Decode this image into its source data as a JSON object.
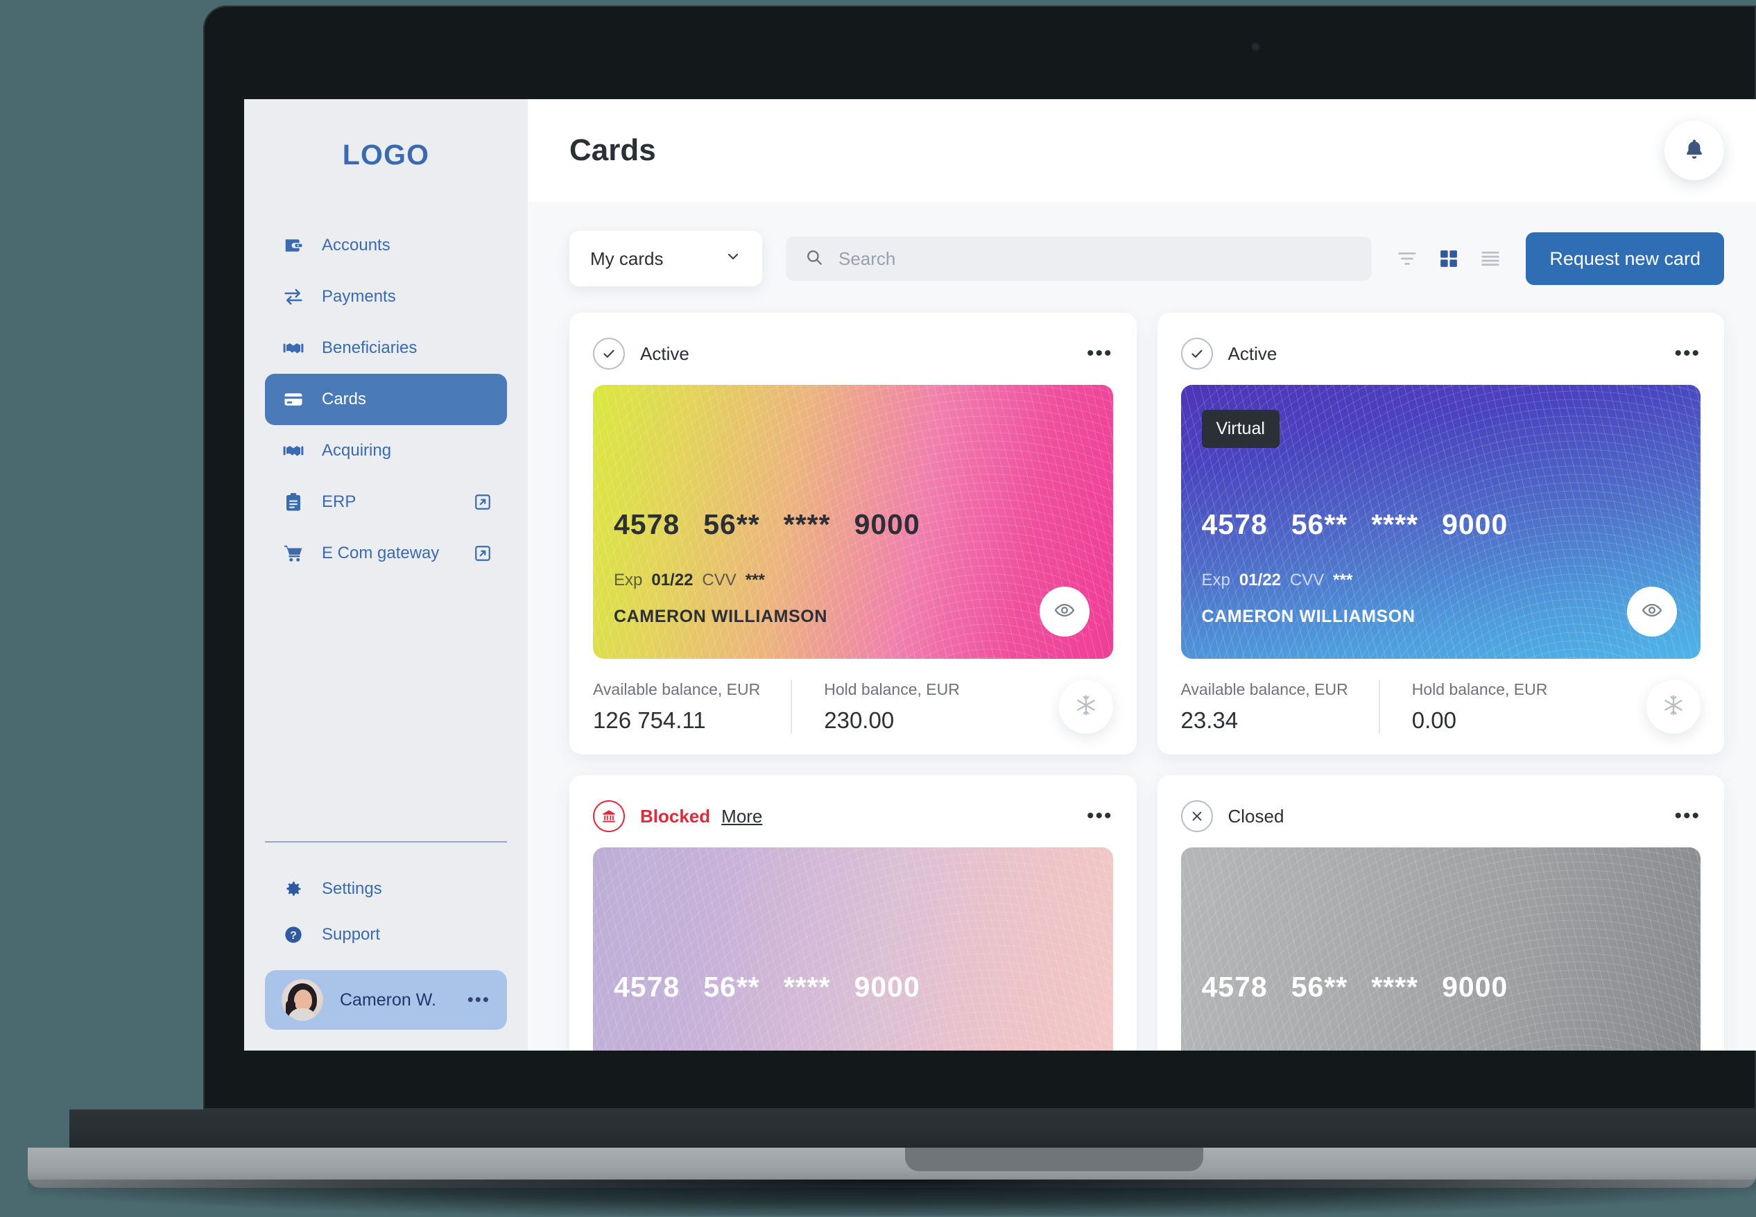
{
  "brand": {
    "logo": "LOGO",
    "accent": "#3a6bb0",
    "active_bg": "#4b7ab8",
    "primary_button": "#2f6db4",
    "danger": "#e02a3c"
  },
  "sidebar": {
    "items": [
      {
        "label": "Accounts",
        "icon": "wallet-icon",
        "external": false,
        "active": false
      },
      {
        "label": "Payments",
        "icon": "transfer-arrows-icon",
        "external": false,
        "active": false
      },
      {
        "label": "Beneficiaries",
        "icon": "handshake-icon",
        "external": false,
        "active": false
      },
      {
        "label": "Cards",
        "icon": "credit-card-icon",
        "external": false,
        "active": true
      },
      {
        "label": "Acquiring",
        "icon": "handshake-icon",
        "external": false,
        "active": false
      },
      {
        "label": "ERP",
        "icon": "clipboard-icon",
        "external": true,
        "active": false
      },
      {
        "label": "E Com gateway",
        "icon": "shopping-cart-icon",
        "external": true,
        "active": false
      }
    ],
    "bottom_items": [
      {
        "label": "Settings",
        "icon": "gear-icon"
      },
      {
        "label": "Support",
        "icon": "question-circle-icon"
      }
    ],
    "user": {
      "name": "Cameron W.",
      "menu": "•••",
      "avatar": "user-avatar"
    }
  },
  "header": {
    "title": "Cards",
    "bell": "bell-icon"
  },
  "toolbar": {
    "filter_select": {
      "value": "My cards",
      "chevron": "chevron-down-icon"
    },
    "search": {
      "placeholder": "Search",
      "value": "",
      "icon": "search-icon"
    },
    "view_modes": [
      {
        "name": "filter-icon",
        "active": false
      },
      {
        "name": "grid-view-icon",
        "active": true
      },
      {
        "name": "list-view-icon",
        "active": false
      }
    ],
    "request_button": "Request new card"
  },
  "labels": {
    "available_balance": "Available balance, EUR",
    "hold_balance": "Hold balance, EUR",
    "exp": "Exp",
    "cvv": "CVV",
    "more": "More",
    "menu_dots": "•••"
  },
  "cards": [
    {
      "status": "Active",
      "status_icon": "check-circle-icon",
      "theme": "cc-pink",
      "text_theme": "dark",
      "badge": null,
      "number_groups": [
        "4578",
        "56**",
        "****",
        "9000"
      ],
      "exp": "01/22",
      "cvv": "***",
      "holder": "CAMERON WILLIAMSON",
      "available_balance": "126 754.11",
      "hold_balance": "230.00",
      "eye": "eye-icon",
      "freeze": "snowflake-icon"
    },
    {
      "status": "Active",
      "status_icon": "check-circle-icon",
      "theme": "cc-blue",
      "text_theme": "light",
      "badge": "Virtual",
      "number_groups": [
        "4578",
        "56**",
        "****",
        "9000"
      ],
      "exp": "01/22",
      "cvv": "***",
      "holder": "CAMERON WILLIAMSON",
      "available_balance": "23.34",
      "hold_balance": "0.00",
      "eye": "eye-icon",
      "freeze": "snowflake-icon"
    },
    {
      "status": "Blocked",
      "status_icon": "bank-icon",
      "theme": "cc-violet",
      "text_theme": "light",
      "badge": null,
      "number_groups": [
        "4578",
        "56**",
        "****",
        "9000"
      ],
      "more": "More"
    },
    {
      "status": "Closed",
      "status_icon": "x-circle-icon",
      "theme": "cc-grey",
      "text_theme": "light",
      "badge": null,
      "number_groups": [
        "4578",
        "56**",
        "****",
        "9000"
      ]
    }
  ]
}
